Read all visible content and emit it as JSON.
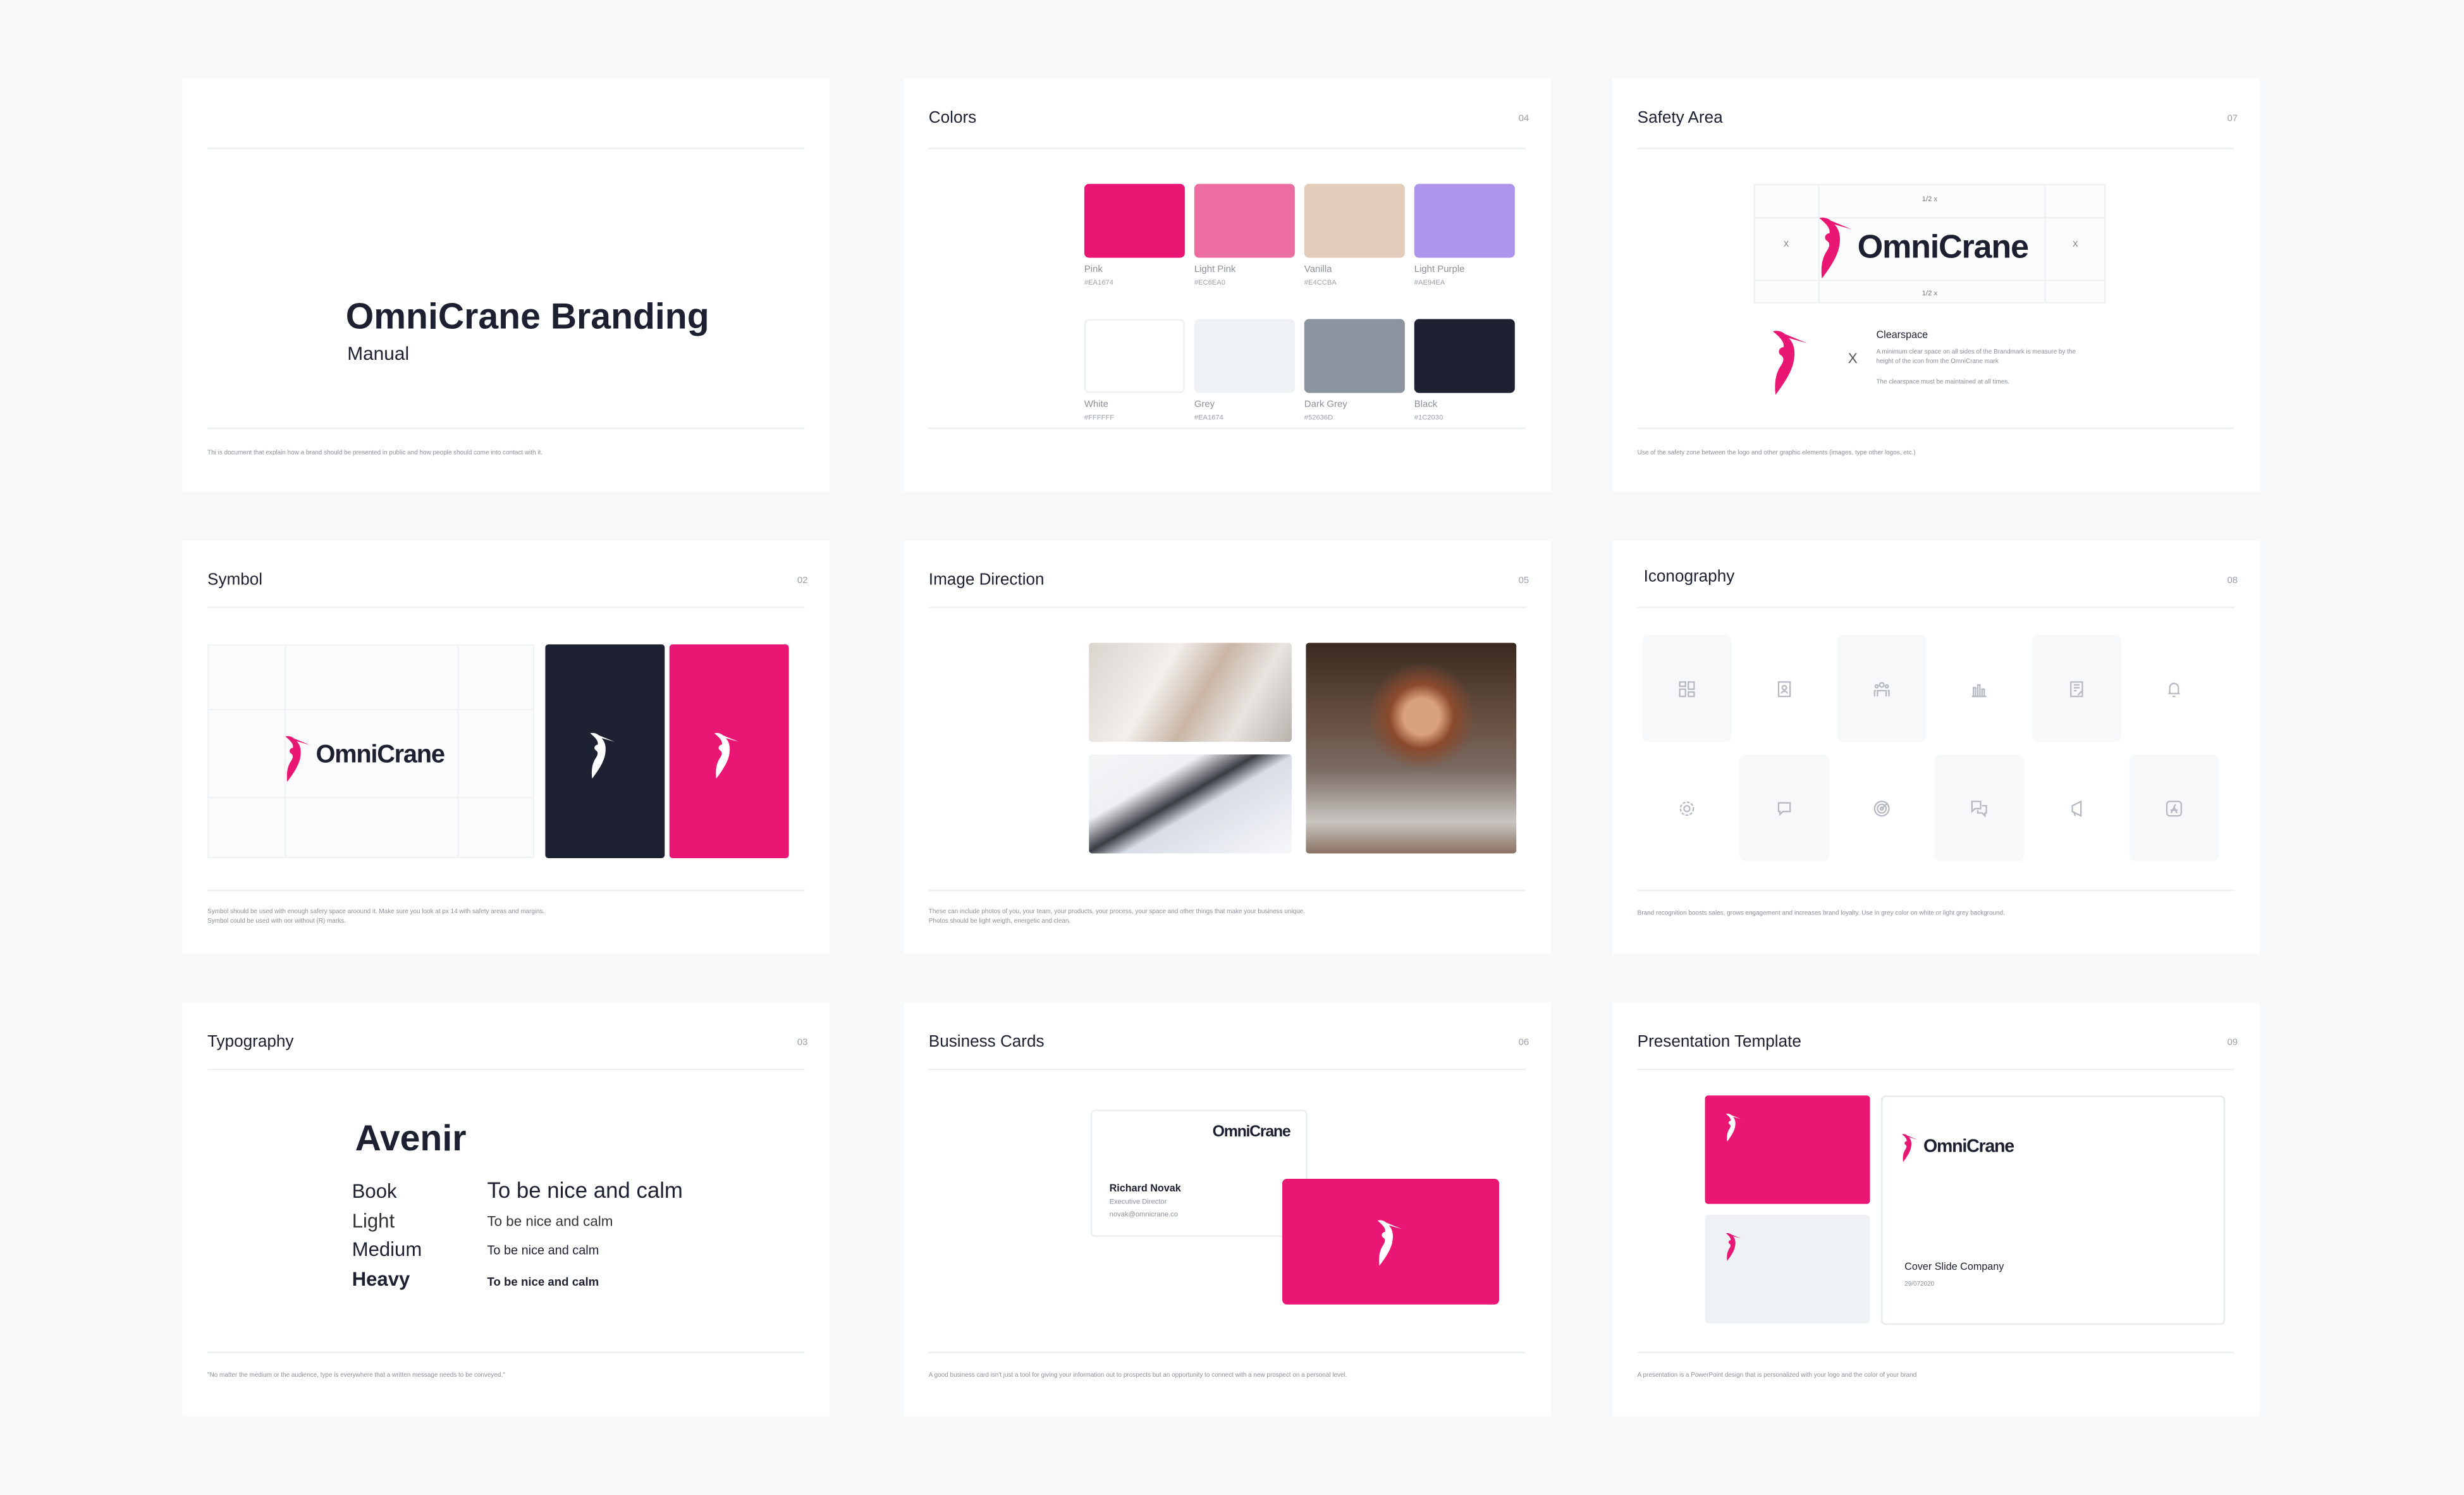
{
  "colors": {
    "pink": "#EA1674",
    "dark": "#1C2030",
    "page_bg": "#F7F8FA"
  },
  "cover": {
    "title": "OmniCrane Branding",
    "subtitle": "Manual",
    "footer": "Thi is document that explain how a brand should be presented in public and how people should come into contact with it."
  },
  "colors_page": {
    "title": "Colors",
    "number": "04",
    "swatches": [
      {
        "name": "Pink",
        "hex": "#EA1674",
        "fill": "#EA1674"
      },
      {
        "name": "Light Pink",
        "hex": "#EC6EA0",
        "fill": "#EC6EA0"
      },
      {
        "name": "Vanilla",
        "hex": "#E4CCBA",
        "fill": "#E4CCBA"
      },
      {
        "name": "Light Purple",
        "hex": "#AE94EA",
        "fill": "#AE94EA"
      },
      {
        "name": "White",
        "hex": "#FFFFFF",
        "fill": "#FFFFFF"
      },
      {
        "name": "Grey",
        "hex": "#EA1674",
        "fill": "#EFF2F5"
      },
      {
        "name": "Dark Grey",
        "hex": "#52636D",
        "fill": "#8A939E"
      },
      {
        "name": "Black",
        "hex": "#1C2030",
        "fill": "#1E2132"
      }
    ]
  },
  "safety": {
    "title": "Safety Area",
    "number": "07",
    "half_x": "1/2 x",
    "x": "X",
    "wordmark": "OmniCrane",
    "clearspace_title": "Clearspace",
    "clearspace_text": "A minimum clear space on all sides of the Brandmark is measure by the height of the icon from the OmniCrane mark",
    "clearspace_note": "The clearspace must be maintained at all times.",
    "footer": "Use of the safety zone between the logo and other graphic elements (images, type other logos, etc.)"
  },
  "symbol": {
    "title": "Symbol",
    "number": "02",
    "wordmark": "OmniCrane",
    "footer_1": "Symbol should be used with enough safery space aroound it. Make sure you look at px 14 with safety areas and margins.",
    "footer_2": "Symbol could be used with oor without (R) marks."
  },
  "image_direction": {
    "title": "Image Direction",
    "number": "05",
    "footer_1": "These can include photos of you, your team, your products, your process, your space and other things that make your business unique.",
    "footer_2": "Photos should be light weigth, energetic and clean."
  },
  "iconography": {
    "title": "Iconography",
    "number": "08",
    "icons": [
      "dashboard-icon",
      "contacts-icon",
      "team-icon",
      "bar-chart-icon",
      "document-edit-icon",
      "bell-icon",
      "gear-icon",
      "chat-bubble-icon",
      "target-icon",
      "conversation-icon",
      "megaphone-icon",
      "app-store-icon"
    ],
    "footer": "Brand recognition boosts sales, grows engagement and increases brand loyalty. Use in grey color on white or light grey background."
  },
  "typography": {
    "title": "Typography",
    "number": "03",
    "font_name": "Avenir",
    "weights": [
      {
        "label": "Book",
        "sample": "To be nice and calm"
      },
      {
        "label": "Light",
        "sample": "To be nice and calm"
      },
      {
        "label": "Medium",
        "sample": "To be nice and calm"
      },
      {
        "label": "Heavy",
        "sample": "To be nice and calm"
      }
    ],
    "footer": "\"No matter the medium or the audience, type is everywhere that a written message needs to be conveyed,\""
  },
  "business_cards": {
    "title": "Business Cards",
    "number": "06",
    "wordmark": "OmniCrane",
    "name": "Richard Novak",
    "role": "Executive Director",
    "email": "novak@omnicrane.co",
    "footer": "A good business card isn't just a tool for giving your information out to prospects but an opportunity to connect with a new prospect on a personal level."
  },
  "presentation": {
    "title": "Presentation Template",
    "number": "09",
    "wordmark": "OmniCrane",
    "slide_title": "Cover Slide Company",
    "date": "29/072020",
    "footer": "A presentation is a PowerPoint design that is personalized with your logo and the color of your brand"
  }
}
